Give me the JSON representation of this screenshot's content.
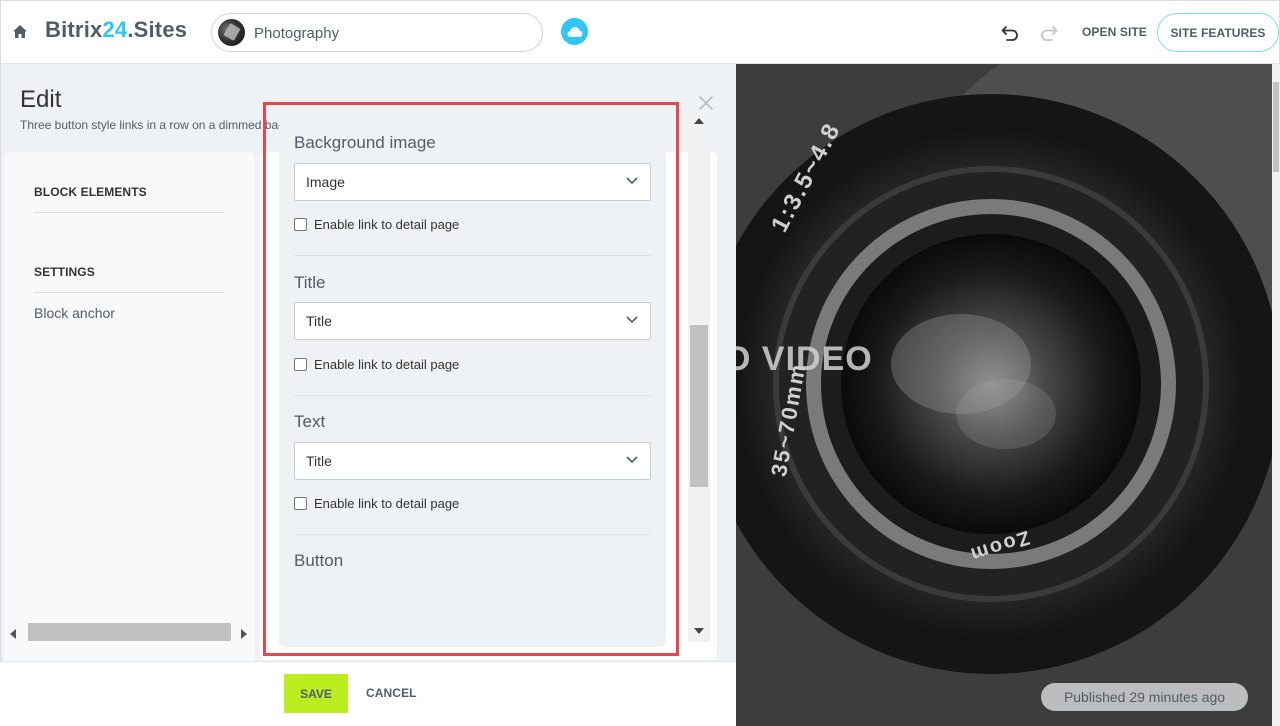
{
  "header": {
    "brand_prefix": "Bitrix",
    "brand_number": "24",
    "brand_suffix": ".Sites",
    "site_name": "Photography",
    "open_site_label": "OPEN SITE",
    "site_features_label": "SITE FEATURES"
  },
  "edit_panel": {
    "title": "Edit",
    "subtitle": "Three button style links in a row on a dimmed background image"
  },
  "nav": {
    "section_block_elements": "BLOCK ELEMENTS",
    "section_settings": "SETTINGS",
    "item_block_anchor": "Block anchor"
  },
  "form": {
    "groups": [
      {
        "label": "Background image",
        "value": "Image",
        "checkbox_label": "Enable link to detail page",
        "checked": false
      },
      {
        "label": "Title",
        "value": "Title",
        "checkbox_label": "Enable link to detail page",
        "checked": false
      },
      {
        "label": "Text",
        "value": "Title",
        "checkbox_label": "Enable link to detail page",
        "checked": false
      },
      {
        "label": "Button"
      }
    ]
  },
  "footer": {
    "save_label": "SAVE",
    "cancel_label": "CANCEL"
  },
  "preview": {
    "overlay_text": "O VIDEO",
    "lens_text_top": "1:3.5~4.8",
    "lens_text_left": "35~70mm",
    "lens_text_bottom": "Zoom",
    "published_label": "Published 29 minutes ago"
  },
  "colors": {
    "accent": "#2fc6f6",
    "save_button": "#bbed21",
    "highlight": "#e8474d"
  }
}
